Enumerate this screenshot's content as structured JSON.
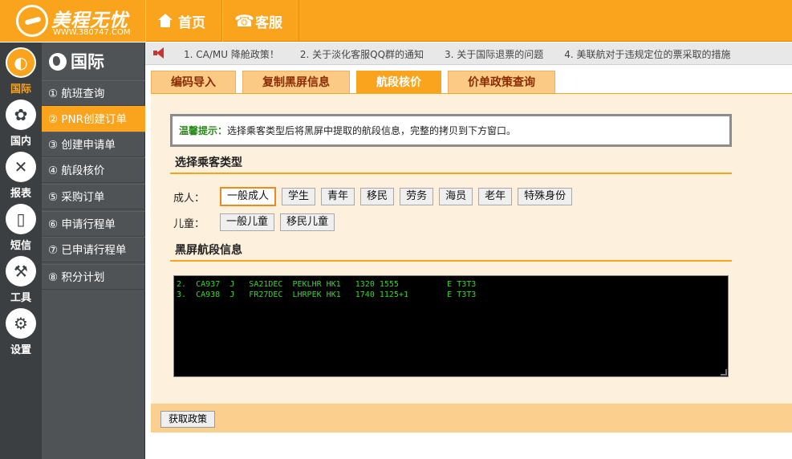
{
  "brand": {
    "name": "美程无忧",
    "url": "WWW.380747.COM"
  },
  "topnav": [
    {
      "label": "首页",
      "icon": "home-icon"
    },
    {
      "label": "客服",
      "icon": "phone-icon"
    }
  ],
  "rail": [
    {
      "label": "国际",
      "icon": "globe-icon",
      "active": true
    },
    {
      "label": "国内",
      "icon": "china-map-icon",
      "active": false
    },
    {
      "label": "报表",
      "icon": "report-icon",
      "active": false
    },
    {
      "label": "短信",
      "icon": "mobile-icon",
      "active": false
    },
    {
      "label": "工具",
      "icon": "tools-icon",
      "active": false
    },
    {
      "label": "设置",
      "icon": "gear-icon",
      "active": false
    }
  ],
  "sidebar": {
    "title": "国际",
    "items": [
      {
        "label": "① 航班查询",
        "active": false
      },
      {
        "label": "② PNR创建订单",
        "active": true
      },
      {
        "label": "③ 创建申请单",
        "active": false
      },
      {
        "label": "④ 航段核价",
        "active": false
      },
      {
        "label": "⑤ 采购订单",
        "active": false
      },
      {
        "label": "⑥ 申请行程单",
        "active": false
      },
      {
        "label": "⑦ 已申请行程单",
        "active": false
      },
      {
        "label": "⑧ 积分计划",
        "active": false
      }
    ]
  },
  "notices": [
    "1. CA/MU 降舱政策！",
    "2. 关于淡化客服QQ群的通知",
    "3. 关于国际退票的问题",
    "4. 美联航对于违规定位的票采取的措施"
  ],
  "tabs": [
    {
      "label": "编码导入",
      "active": false
    },
    {
      "label": "复制黑屏信息",
      "active": false
    },
    {
      "label": "航段核价",
      "active": true
    },
    {
      "label": "价单政策查询",
      "active": false
    }
  ],
  "hint": {
    "prefix": "温馨提示：",
    "text": "选择乘客类型后将黑屏中提取的航段信息，完整的拷贝到下方窗口。"
  },
  "passenger_section": {
    "title": "选择乘客类型",
    "adult_label": "成人：",
    "adult_options": [
      "一般成人",
      "学生",
      "青年",
      "移民",
      "劳务",
      "海员",
      "老年",
      "特殊身份"
    ],
    "adult_selected": "一般成人",
    "child_label": "儿童：",
    "child_options": [
      "一般儿童",
      "移民儿童"
    ]
  },
  "terminal_section": {
    "title": "黑屏航段信息",
    "lines": [
      "2.  CA937  J   SA21DEC  PEKLHR HK1   1320 1555          E T3T3",
      "3.  CA938  J   FR27DEC  LHRPEK HK1   1740 1125+1        E T3T3"
    ]
  },
  "footer": {
    "get_policy_label": "获取政策"
  },
  "colors": {
    "accent": "#f9a41c",
    "rail": "#3c3f42",
    "sidebar": "#4f5356",
    "terminal_text": "#36d62b"
  }
}
